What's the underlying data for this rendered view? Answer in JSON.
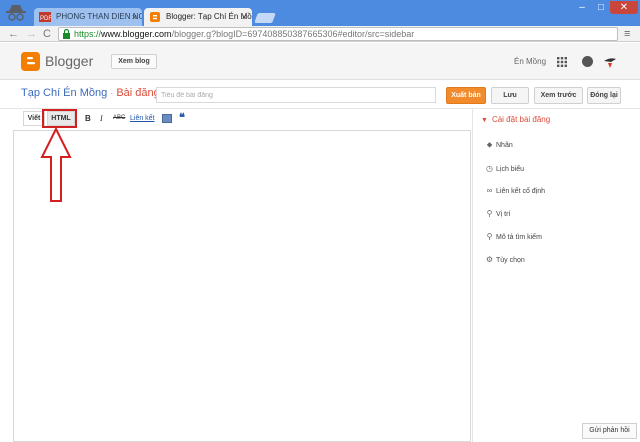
{
  "browser": {
    "tabs": [
      {
        "title": "PHONG THAN DIEN NGH",
        "icon": "pdf-icon"
      },
      {
        "title": "Blogger: Tạp Chí Én Mồng",
        "icon": "blogger-icon"
      }
    ],
    "tab_close": "×",
    "url": {
      "scheme": "https://",
      "domain": "www.blogger.com",
      "path": "/blogger.g?blogID=697408850387665306#editor/src=sidebar"
    },
    "nav": {
      "back": "←",
      "forward": "→",
      "reload": "C",
      "menu": "≡"
    },
    "window": {
      "minimize": "–",
      "maximize": "□",
      "close": "✕"
    }
  },
  "header": {
    "brand": "Blogger",
    "view_blog": "Xem blog",
    "username": "Én Mồng"
  },
  "postbar": {
    "blog_title": "Tạp Chí Én Mồng",
    "separator": "·",
    "section": "Bài đăng",
    "title_placeholder": "Tiêu đề bài đăng",
    "publish": "Xuất bản",
    "save": "Lưu",
    "preview": "Xem trước",
    "close": "Đóng lại"
  },
  "editor_toolbar": {
    "compose": "Viết",
    "html": "HTML",
    "bold": "B",
    "italic": "I",
    "strike": "ABC",
    "link": "Liên kết",
    "quote": "❝"
  },
  "sidebar": {
    "heading": "Cài đặt bài đăng",
    "caret": "▼",
    "items": [
      {
        "label": "Nhãn",
        "icon": "tag-icon",
        "glyph": "⬥"
      },
      {
        "label": "Lịch biểu",
        "icon": "clock-icon",
        "glyph": "◷"
      },
      {
        "label": "Liên kết cố định",
        "icon": "link-icon",
        "glyph": "∞"
      },
      {
        "label": "Vị trí",
        "icon": "location-pin-icon",
        "glyph": "⚲"
      },
      {
        "label": "Mô tả tìm kiếm",
        "icon": "search-icon",
        "glyph": "⚲"
      },
      {
        "label": "Tùy chọn",
        "icon": "gear-icon",
        "glyph": "⚙"
      }
    ]
  },
  "feedback": "Gửi phản hồi",
  "colors": {
    "accent": "#f57d00",
    "link": "#3c6bbf",
    "red": "#dd4b39",
    "annotation": "#d21f1f"
  }
}
